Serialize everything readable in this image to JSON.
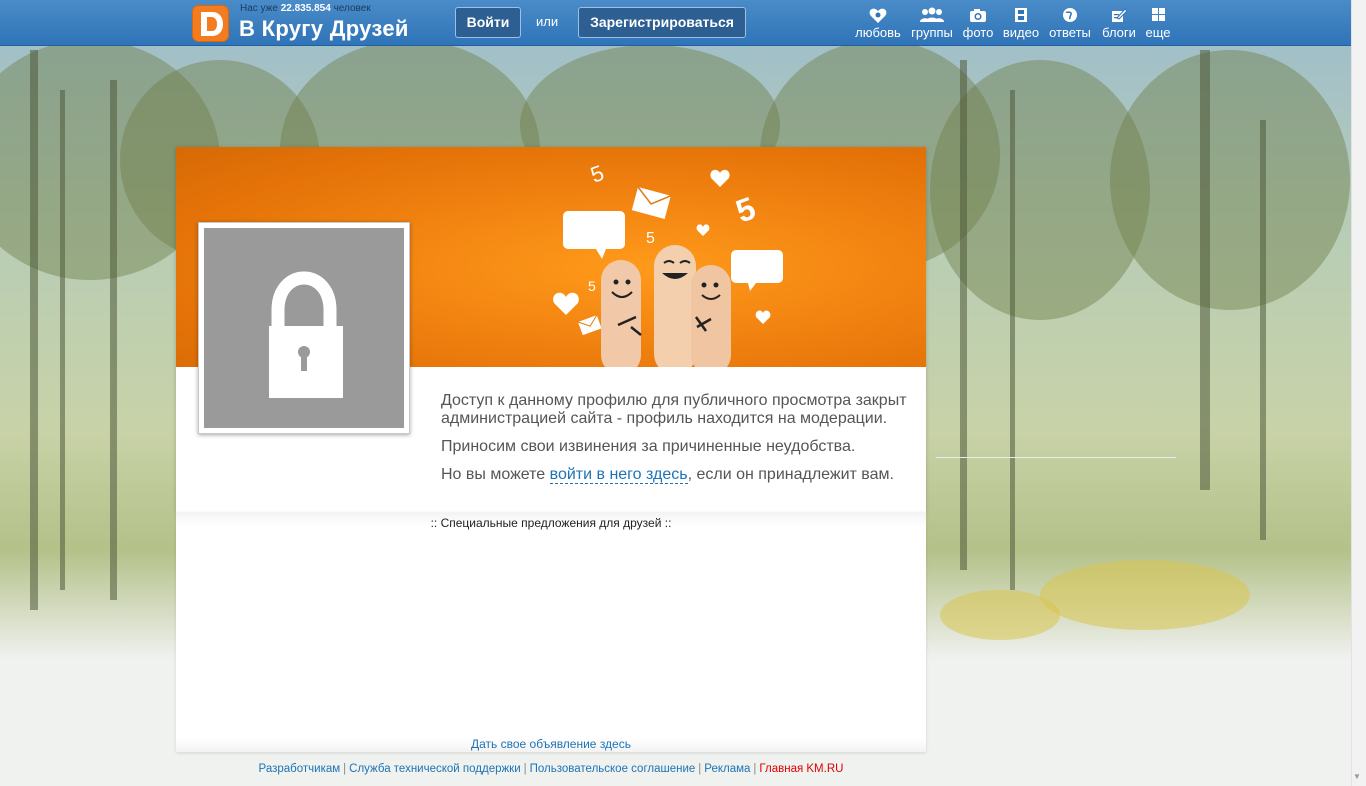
{
  "header": {
    "count_prefix": "Нас уже",
    "count_value": "22.835.854",
    "count_suffix": "человек",
    "site_title": "В Кругу  Друзей",
    "login_label": "Войти",
    "or_label": "или",
    "register_label": "Зарегистрироваться",
    "nav": [
      {
        "label": "любовь",
        "icon": "heart-icon"
      },
      {
        "label": "группы",
        "icon": "people-icon"
      },
      {
        "label": "фото",
        "icon": "camera-icon"
      },
      {
        "label": "видео",
        "icon": "film-icon"
      },
      {
        "label": "ответы",
        "icon": "globe-icon"
      },
      {
        "label": "блоги",
        "icon": "pencil-note-icon"
      },
      {
        "label": "еще",
        "icon": "grid-icon"
      }
    ]
  },
  "profile": {
    "avatar_icon": "lock-icon",
    "message_line1": "Доступ к данному профилю для публичного просмотра закрыт администрацией сайта - профиль находится на модерации.",
    "message_line2": "Приносим свои извинения за причиненные неудобства.",
    "message_line3_prefix": "Но вы можете ",
    "message_line3_link": "войти в него здесь",
    "message_line3_suffix": ", если он принадлежит вам."
  },
  "offers": {
    "title": ":: Специальные предложения для друзей ::",
    "ad_link": "Дать свое объявление здесь"
  },
  "footer": {
    "links": [
      "Разработчикам",
      "Служба технической поддержки",
      "Пользовательское соглашение",
      "Реклама"
    ],
    "main_link": "Главная KM.RU"
  },
  "colors": {
    "topbar": "#2f74b8",
    "accent_orange": "#f28411",
    "link": "#1e73b5",
    "main_link": "#e00000"
  }
}
